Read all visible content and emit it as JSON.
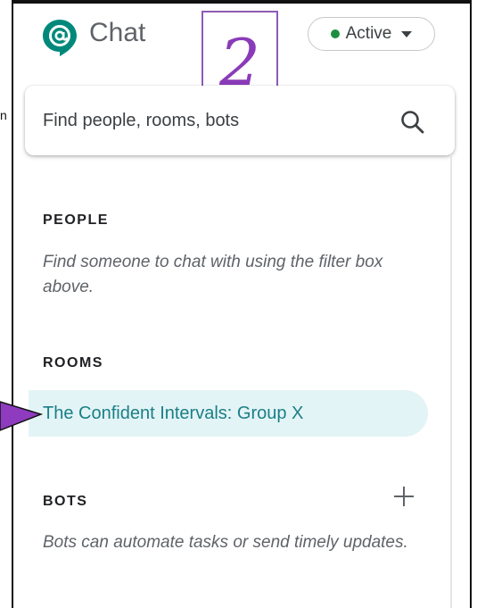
{
  "app": {
    "title": "Chat",
    "brand_color": "#00897b"
  },
  "status": {
    "label": "Active",
    "indicator_color": "#1e8e3e"
  },
  "annotation": {
    "step_number": "2",
    "color": "#8a3bb8"
  },
  "search": {
    "placeholder": "Find people, rooms, bots",
    "value": ""
  },
  "outside": {
    "fragment": "n"
  },
  "sections": {
    "people": {
      "heading": "PEOPLE",
      "description": "Find someone to chat with using the filter box above."
    },
    "rooms": {
      "heading": "ROOMS",
      "items": [
        {
          "label": "The Confident Intervals: Group X"
        }
      ]
    },
    "bots": {
      "heading": "BOTS",
      "description": "Bots can automate tasks or send timely updates."
    }
  },
  "icons": {
    "logo": "chat-logo-icon",
    "search": "search-icon",
    "caret": "caret-down-icon",
    "add": "plus-icon",
    "arrow": "arrow-right-icon"
  }
}
